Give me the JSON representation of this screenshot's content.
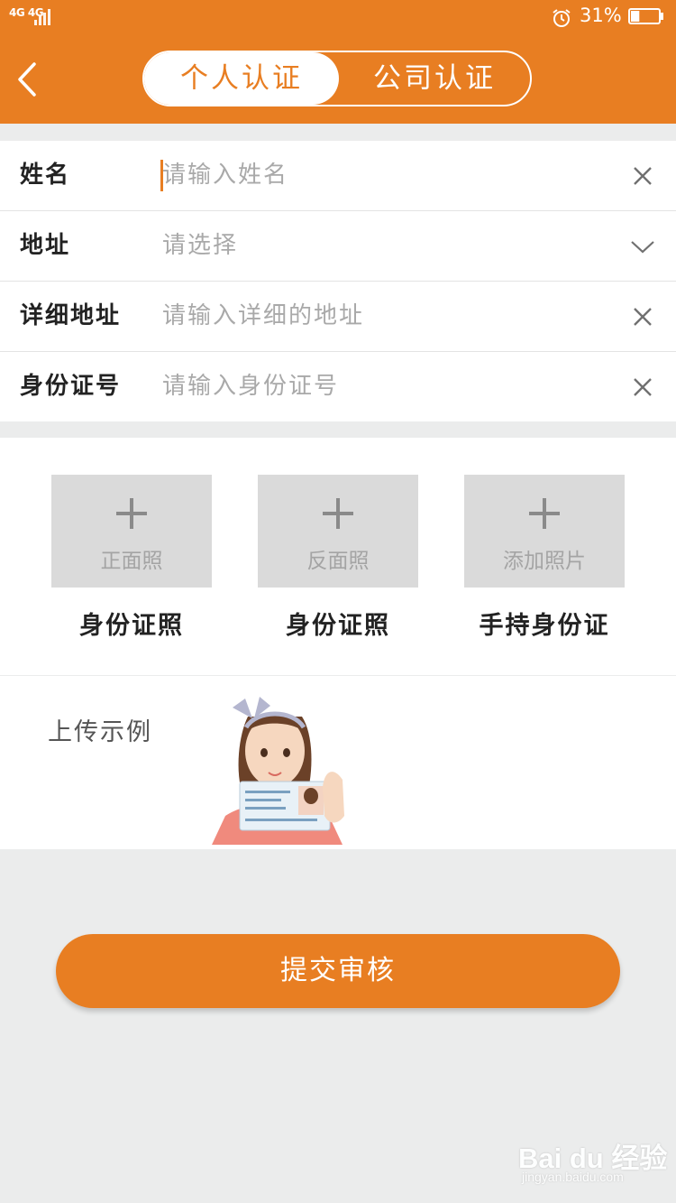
{
  "status_bar": {
    "network": "4G 4G",
    "battery_percent": "31%",
    "battery_level": 0.31
  },
  "header": {
    "tabs": [
      {
        "label": "个人认证",
        "active": true
      },
      {
        "label": "公司认证",
        "active": false
      }
    ]
  },
  "form": {
    "rows": [
      {
        "label": "姓名",
        "placeholder": "请输入姓名",
        "action_icon": "close-icon"
      },
      {
        "label": "地址",
        "placeholder": "请选择",
        "action_icon": "chevron-down-icon"
      },
      {
        "label": "详细地址",
        "placeholder": "请输入详细的地址",
        "action_icon": "close-icon"
      },
      {
        "label": "身份证号",
        "placeholder": "请输入身份证号",
        "action_icon": "close-icon"
      }
    ]
  },
  "photos": [
    {
      "box_label": "正面照",
      "caption": "身份证照"
    },
    {
      "box_label": "反面照",
      "caption": "身份证照"
    },
    {
      "box_label": "添加照片",
      "caption": "手持身份证"
    }
  ],
  "example": {
    "label": "上传示例"
  },
  "submit_label": "提交审核",
  "watermark": {
    "brand": "Bai du 经验",
    "url": "jingyan.baidu.com"
  },
  "colors": {
    "accent": "#e87e22",
    "background": "#ebecec",
    "placeholder": "#a9a9a9",
    "photo_box": "#dadada"
  }
}
